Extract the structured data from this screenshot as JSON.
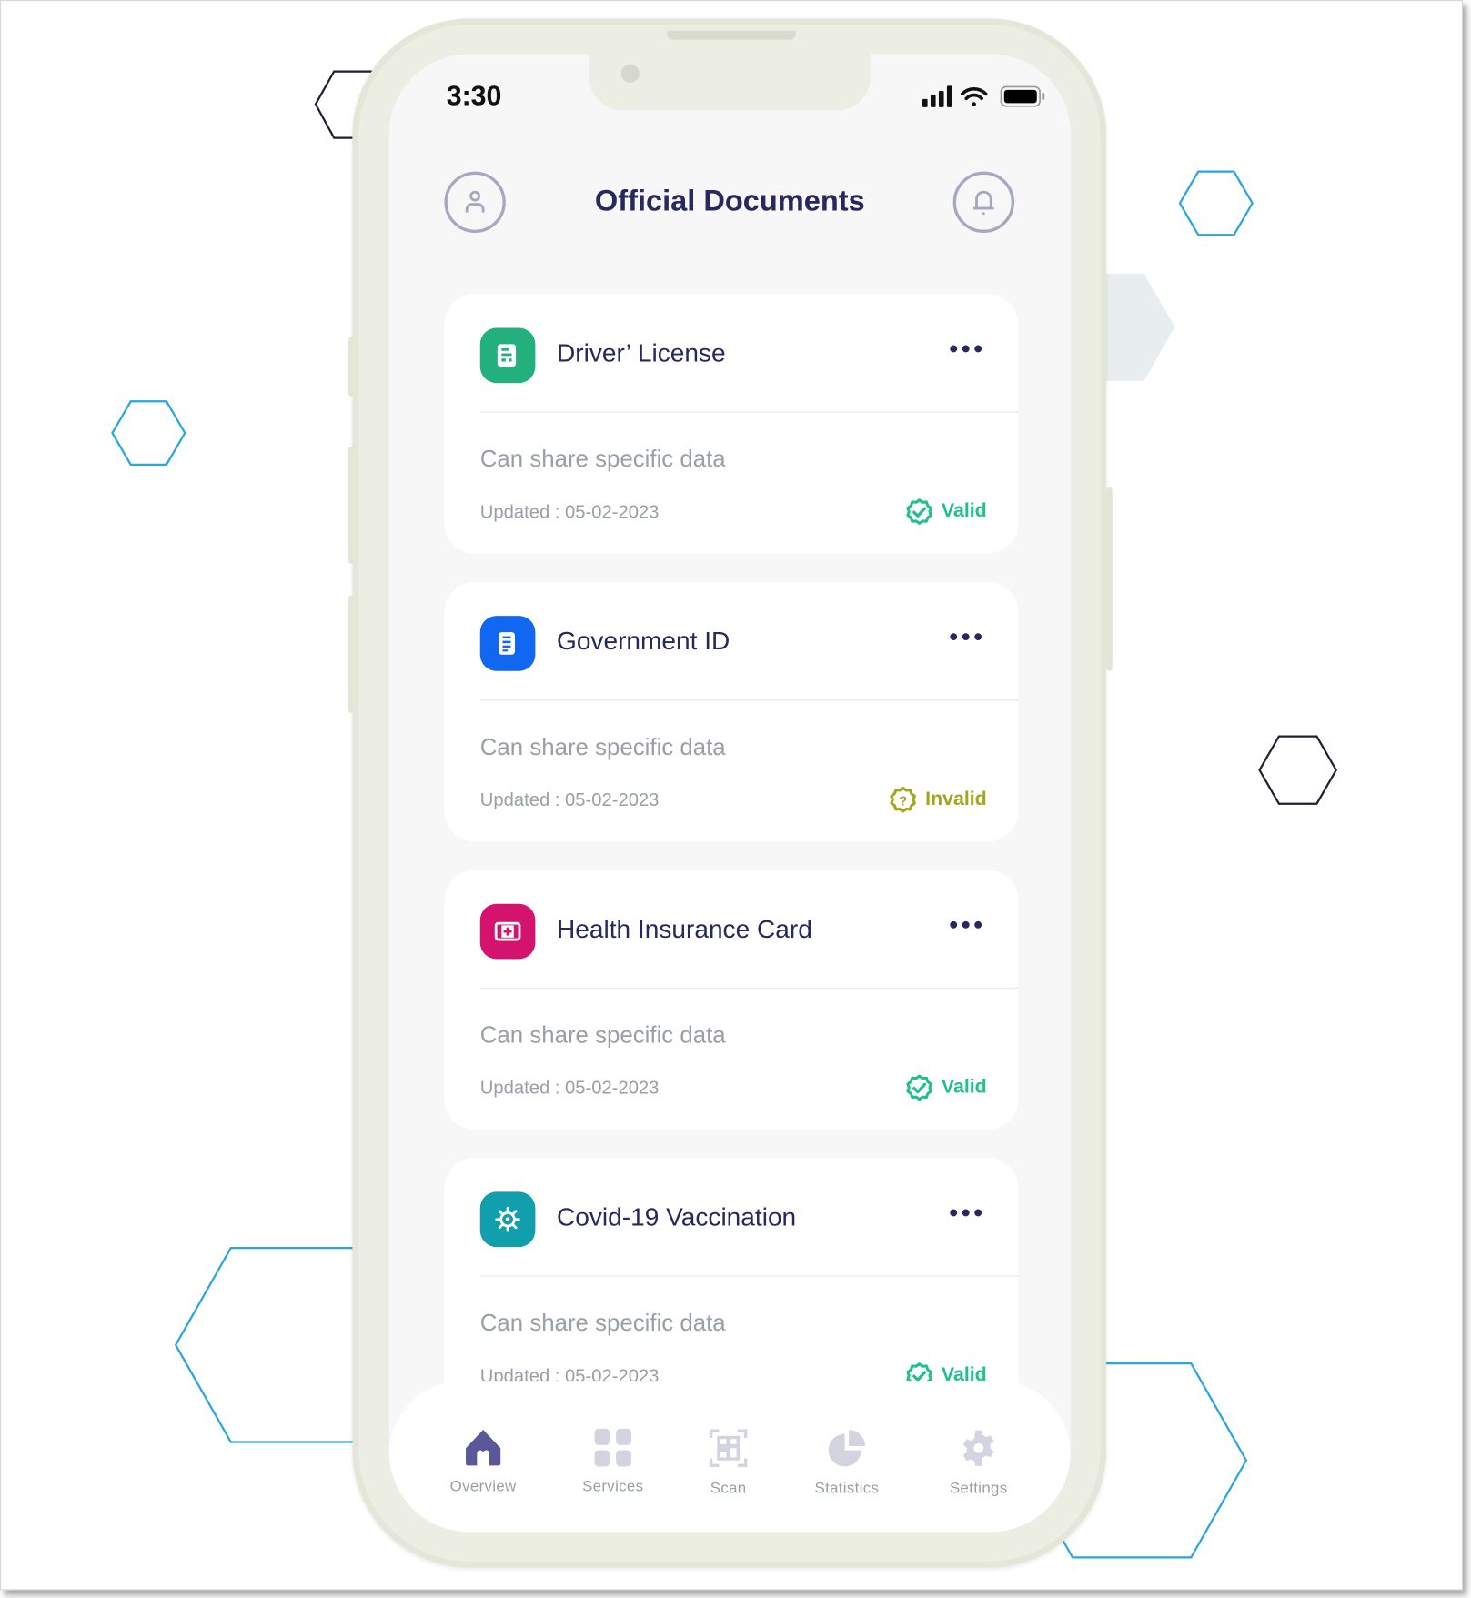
{
  "status_bar": {
    "time": "3:30"
  },
  "header": {
    "title": "Official Documents",
    "profile_icon": "user-icon",
    "notification_icon": "bell-icon"
  },
  "documents": [
    {
      "title": "Driver’ License",
      "subtitle": "Can share specific data",
      "updated": "Updated : 05-02-2023",
      "status": "Valid",
      "icon": "license-icon",
      "icon_color": "#22b07d",
      "status_color": "#1fc08a"
    },
    {
      "title": "Government ID",
      "subtitle": "Can share specific data",
      "updated": "Updated : 05-02-2023",
      "status": "Invalid",
      "icon": "id-document-icon",
      "icon_color": "#1167f2",
      "status_color": "#a3a51a"
    },
    {
      "title": "Health Insurance Card",
      "subtitle": "Can share specific data",
      "updated": "Updated : 05-02-2023",
      "status": "Valid",
      "icon": "medical-card-icon",
      "icon_color": "#d4136f",
      "status_color": "#1fc08a"
    },
    {
      "title": "Covid-19 Vaccination",
      "subtitle": "Can share specific data",
      "updated": "Updated : 05-02-2023",
      "status": "Valid",
      "icon": "virus-icon",
      "icon_color": "#119fae",
      "status_color": "#1fc08a"
    }
  ],
  "nav": {
    "active": "Overview",
    "active_color": "#5a5899",
    "inactive_color": "#d4d4e0",
    "items": [
      {
        "label": "Overview",
        "icon": "home-icon"
      },
      {
        "label": "Services",
        "icon": "grid-icon"
      },
      {
        "label": "Scan",
        "icon": "qr-scan-icon"
      },
      {
        "label": "Statistics",
        "icon": "pie-chart-icon"
      },
      {
        "label": "Settings",
        "icon": "gear-icon"
      }
    ]
  }
}
